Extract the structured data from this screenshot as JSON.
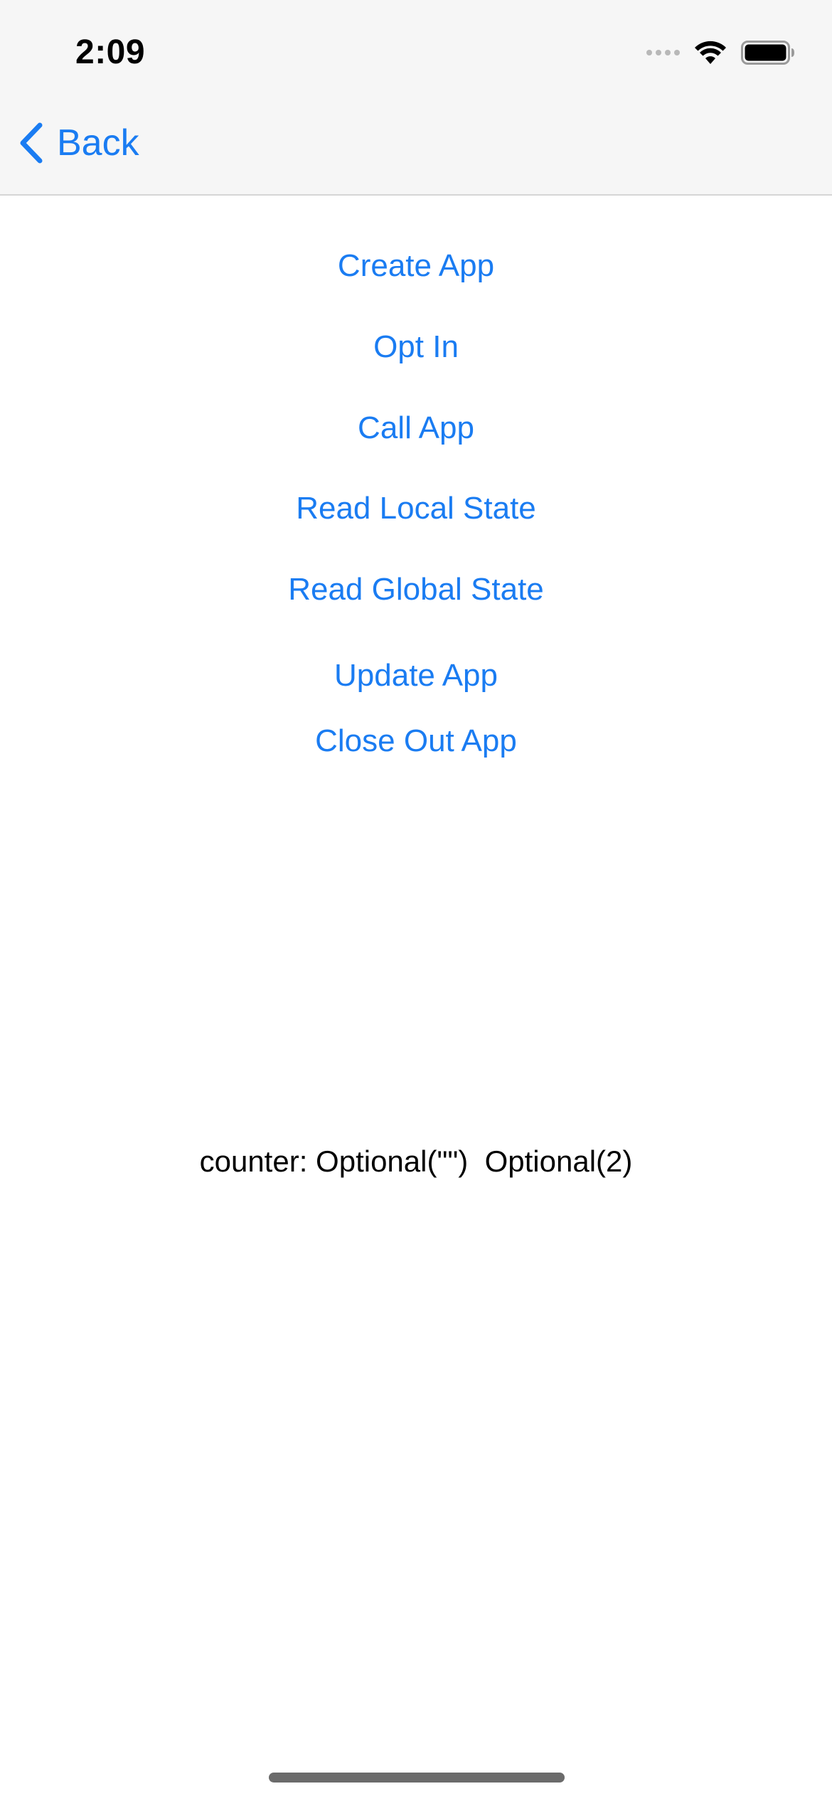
{
  "status_bar": {
    "time": "2:09",
    "signal_icon": "cellular-signal-icon",
    "wifi_icon": "wifi-icon",
    "battery_icon": "battery-icon"
  },
  "nav": {
    "back_label": "Back",
    "back_icon": "chevron-left-icon"
  },
  "actions": {
    "create_app": "Create App",
    "opt_in": "Opt In",
    "call_app": "Call App",
    "read_local_state": "Read Local State",
    "read_global_state": "Read Global State",
    "update_app": "Update App",
    "close_out_app": "Close Out App"
  },
  "output": {
    "counter_text": "counter: Optional(\"\")  Optional(2)"
  },
  "colors": {
    "accent": "#1a7cf2",
    "nav_background": "#f6f6f6",
    "text": "#000000"
  }
}
